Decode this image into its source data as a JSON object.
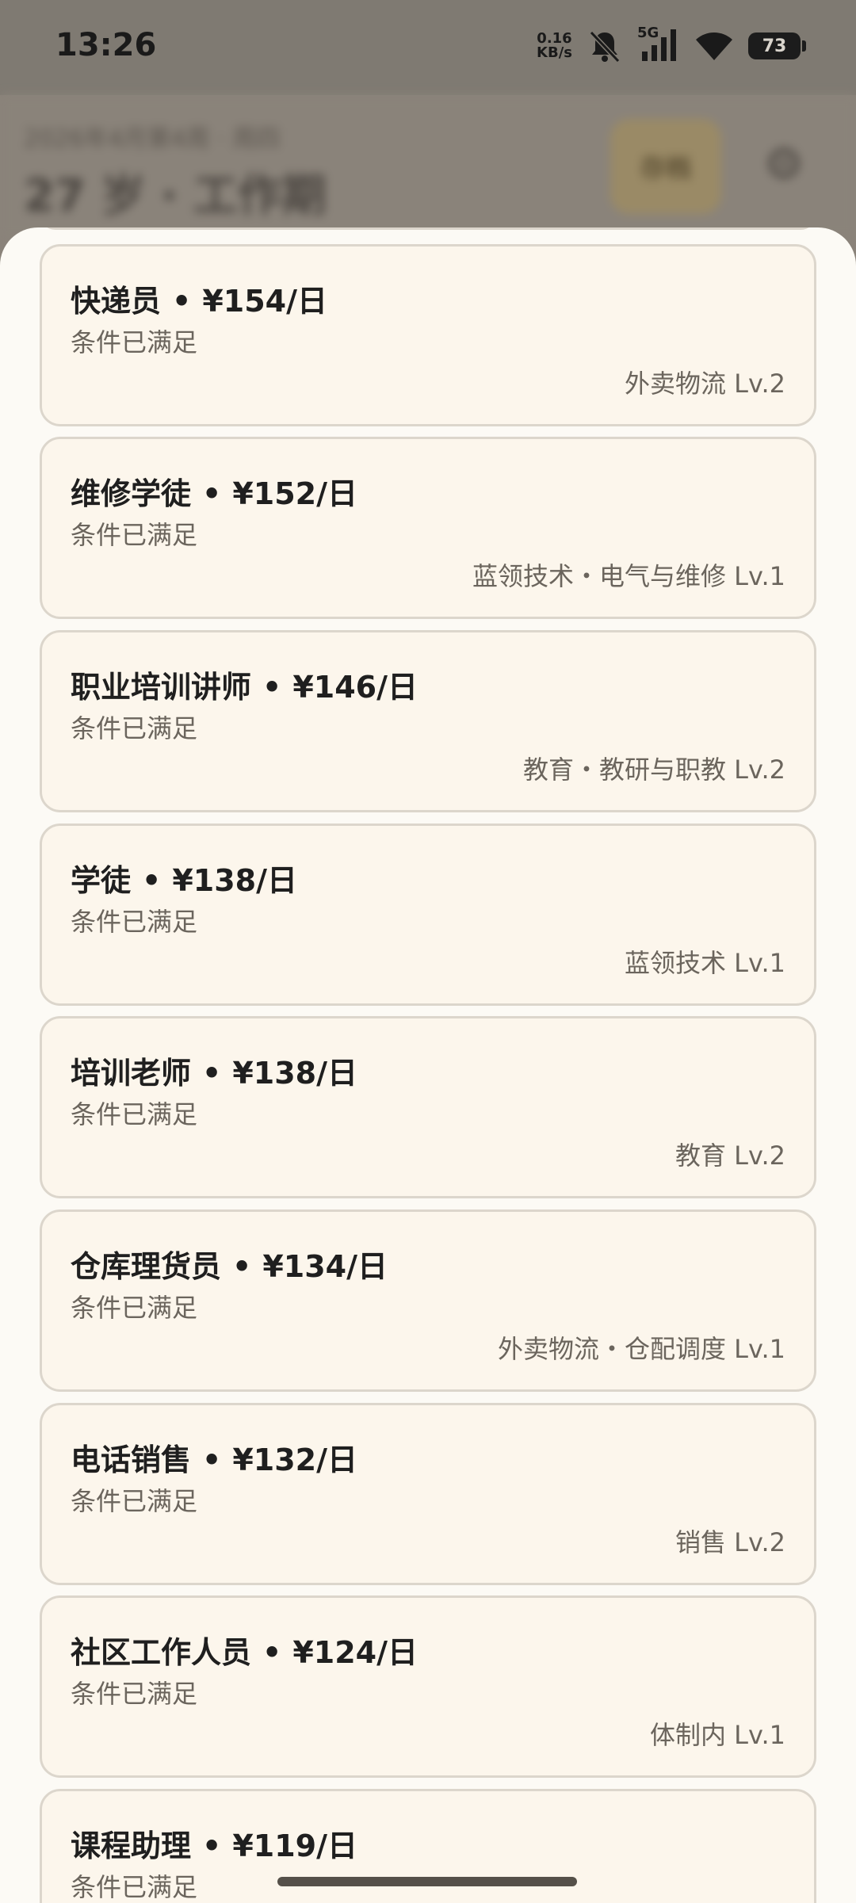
{
  "status_bar": {
    "time": "13:26",
    "net_speed_value": "0.16",
    "net_speed_unit": "KB/s",
    "network_type": "5G",
    "battery": "73"
  },
  "background_header": {
    "subtitle": "2026年4月第4周 · 周四",
    "title": "27 岁 · 工作期",
    "button_label": "存档"
  },
  "jobs": [
    {
      "title": "快递员",
      "wage": "¥154/日",
      "status": "条件已满足",
      "tag": "外卖物流 Lv.2"
    },
    {
      "title": "维修学徒",
      "wage": "¥152/日",
      "status": "条件已满足",
      "tag": "蓝领技术・电气与维修 Lv.1"
    },
    {
      "title": "职业培训讲师",
      "wage": "¥146/日",
      "status": "条件已满足",
      "tag": "教育・教研与职教 Lv.2"
    },
    {
      "title": "学徒",
      "wage": "¥138/日",
      "status": "条件已满足",
      "tag": "蓝领技术 Lv.1"
    },
    {
      "title": "培训老师",
      "wage": "¥138/日",
      "status": "条件已满足",
      "tag": "教育 Lv.2"
    },
    {
      "title": "仓库理货员",
      "wage": "¥134/日",
      "status": "条件已满足",
      "tag": "外卖物流・仓配调度 Lv.1"
    },
    {
      "title": "电话销售",
      "wage": "¥132/日",
      "status": "条件已满足",
      "tag": "销售 Lv.2"
    },
    {
      "title": "社区工作人员",
      "wage": "¥124/日",
      "status": "条件已满足",
      "tag": "体制内 Lv.1"
    },
    {
      "title": "课程助理",
      "wage": "¥119/日",
      "status": "条件已满足",
      "tag": ""
    }
  ],
  "separator": "•"
}
